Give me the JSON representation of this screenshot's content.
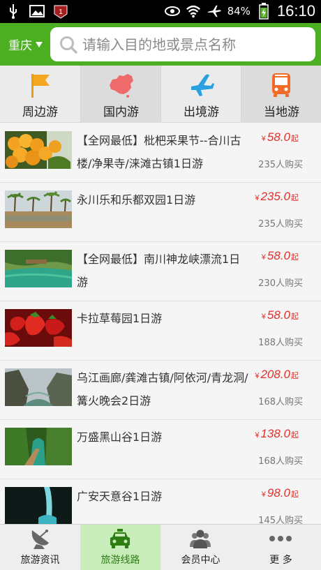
{
  "status_bar": {
    "battery": "84%",
    "time": "16:10",
    "icons": [
      "usb-icon",
      "image-icon",
      "notification-badge-icon",
      "eye-icon",
      "wifi-icon",
      "airplane-icon",
      "battery-icon"
    ],
    "badge_text": "1"
  },
  "header": {
    "city": "重庆",
    "search_placeholder": "请输入目的地或景点名称",
    "accent_color": "#4caf22"
  },
  "categories": [
    {
      "label": "周边游",
      "icon": "flag-icon"
    },
    {
      "label": "国内游",
      "icon": "china-map-icon"
    },
    {
      "label": "出境游",
      "icon": "airplane-icon"
    },
    {
      "label": "当地游",
      "icon": "bus-icon"
    }
  ],
  "tours": [
    {
      "title": "【全网最低】枇杷采果节--合川古楼/净果寺/涞滩古镇1日游",
      "yen": "¥",
      "price": "58.0",
      "unit": "起",
      "sold": "235人购买",
      "thumb": "loquat-fruit"
    },
    {
      "title": "永川乐和乐都双园1日游",
      "yen": "¥",
      "price": "235.0",
      "unit": "起",
      "sold": "235人购买",
      "thumb": "palm-resort"
    },
    {
      "title": "【全网最低】南川神龙峡漂流1日游",
      "yen": "¥",
      "price": "58.0",
      "unit": "起",
      "sold": "230人购买",
      "thumb": "river-gorge"
    },
    {
      "title": "卡拉草莓园1日游",
      "yen": "¥",
      "price": "58.0",
      "unit": "起",
      "sold": "188人购买",
      "thumb": "strawberries"
    },
    {
      "title": "乌江画廊/龚滩古镇/阿依河/青龙洞/篝火晚会2日游",
      "yen": "¥",
      "price": "208.0",
      "unit": "起",
      "sold": "168人购买",
      "thumb": "mountain-river"
    },
    {
      "title": "万盛黑山谷1日游",
      "yen": "¥",
      "price": "138.0",
      "unit": "起",
      "sold": "168人购买",
      "thumb": "valley-path"
    },
    {
      "title": "广安天意谷1日游",
      "yen": "¥",
      "price": "98.0",
      "unit": "起",
      "sold": "145人购买",
      "thumb": "waterfall-cave"
    }
  ],
  "bottom_nav": [
    {
      "label": "旅游资讯",
      "icon": "satellite-dish-icon"
    },
    {
      "label": "旅游线路",
      "icon": "car-icon"
    },
    {
      "label": "会员中心",
      "icon": "members-icon"
    },
    {
      "label": "更 多",
      "icon": "more-dots-icon"
    }
  ],
  "colors": {
    "header_green": "#4caf22",
    "price_red": "#e0302a",
    "active_nav_bg": "#c9ecbb"
  }
}
